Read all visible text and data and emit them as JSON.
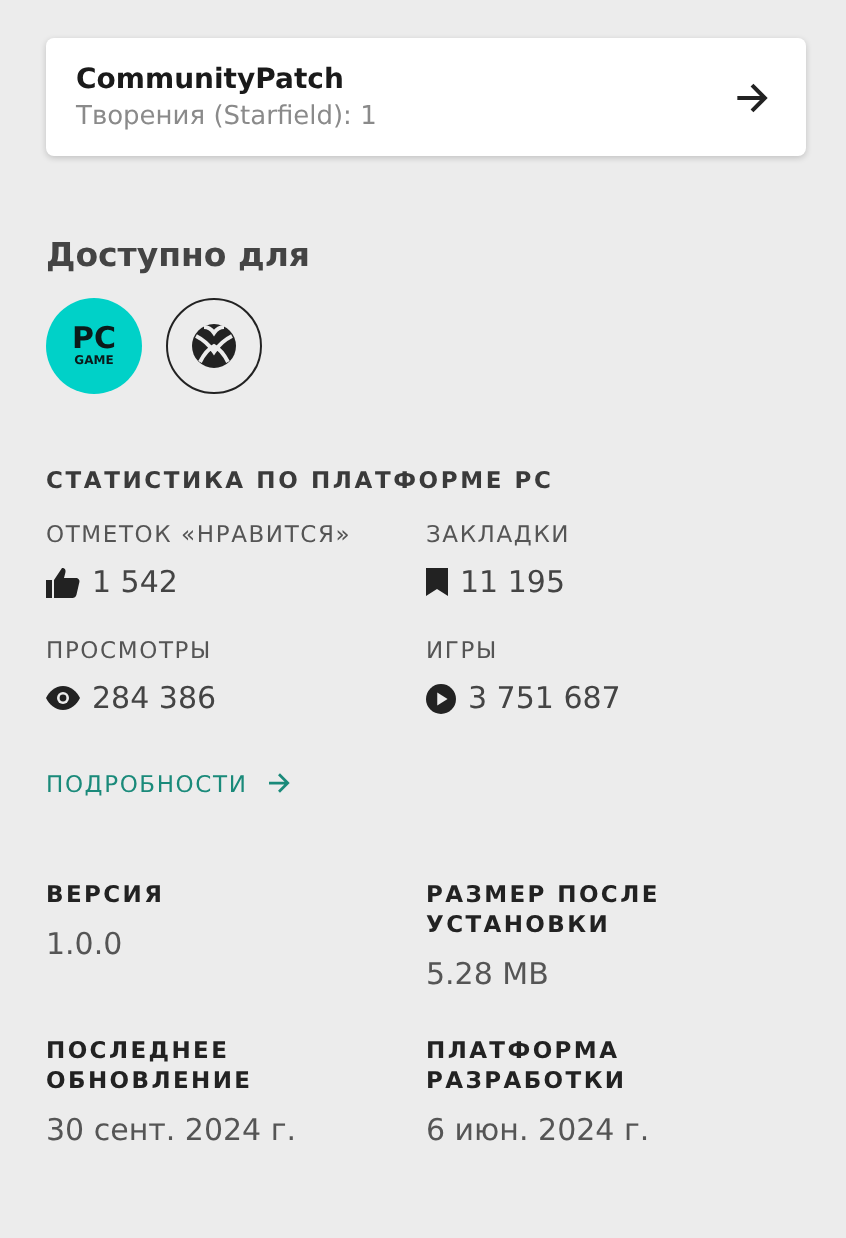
{
  "creator_card": {
    "name": "CommunityPatch",
    "subtitle": "Творения (Starfield): 1"
  },
  "available_for": {
    "title": "Доступно для",
    "platforms": [
      {
        "kind": "pc",
        "label": "PC",
        "sublabel": "GAME"
      },
      {
        "kind": "xbox"
      }
    ]
  },
  "stats": {
    "title": "СТАТИСТИКА ПО ПЛАТФОРМЕ PC",
    "items": [
      {
        "kind": "likes",
        "label": "ОТМЕТОК «НРАВИТСЯ»",
        "value": "1 542"
      },
      {
        "kind": "bookmarks",
        "label": "ЗАКЛАДКИ",
        "value": "11 195"
      },
      {
        "kind": "views",
        "label": "ПРОСМОТРЫ",
        "value": "284 386"
      },
      {
        "kind": "plays",
        "label": "ИГРЫ",
        "value": "3 751 687"
      }
    ],
    "details_link": "ПОДРОБНОСТИ"
  },
  "details": [
    {
      "label": "ВЕРСИЯ",
      "value": "1.0.0"
    },
    {
      "label": "РАЗМЕР ПОСЛЕ УСТАНОВКИ",
      "value": "5.28 MB"
    },
    {
      "label": "ПОСЛЕДНЕЕ ОБНОВЛЕНИЕ",
      "value": "30 сент. 2024 г."
    },
    {
      "label": "ПЛАТФОРМА РАЗРАБОТКИ",
      "value": "6 июн. 2024 г."
    }
  ]
}
